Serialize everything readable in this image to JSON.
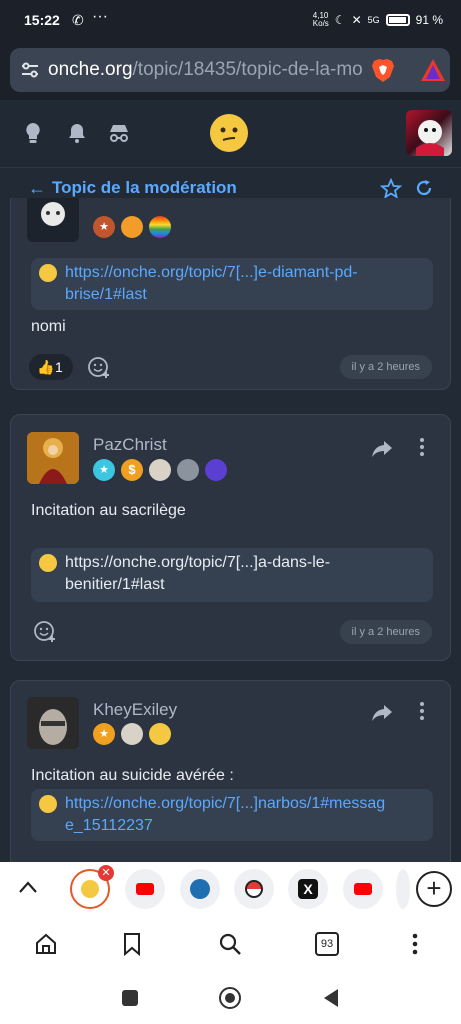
{
  "status_bar": {
    "time": "15:22",
    "speed": "4,10\nKo/s",
    "network": "5G",
    "battery": "91 %"
  },
  "browser": {
    "url_host": "onche.org",
    "url_path": "/topic/18435/topic-de-la-mo"
  },
  "topic": {
    "back_label": "←",
    "title": "Topic de la modération"
  },
  "posts": [
    {
      "link": "https://onche.org/topic/7[...]e-diamant-pd-brise/1#last",
      "link_line1": "https://onche.org/topic/7[...]e-diamant-pd-",
      "link_line2": "brise/1#last",
      "text": "nomi",
      "likes": "1",
      "time": "il y a 2 heures"
    },
    {
      "username": "PazChrist",
      "text": "Incitation au sacrilège",
      "link_line1": "https://onche.org/topic/7[...]a-dans-le-",
      "link_line2": "benitier/1#last",
      "time": "il y a 2 heures"
    },
    {
      "username": "KheyExiley",
      "text": "Incitation au suicide avérée :",
      "link_line1": "https://onche.org/topic/7[...]narbos/1#messag",
      "link_line2": "e_15112237"
    }
  ],
  "tab_strip": {
    "tab_count": "93"
  },
  "colors": {
    "accent_link": "#5aa9ff",
    "card_bg": "#2b3440",
    "page_bg": "#222a35"
  }
}
